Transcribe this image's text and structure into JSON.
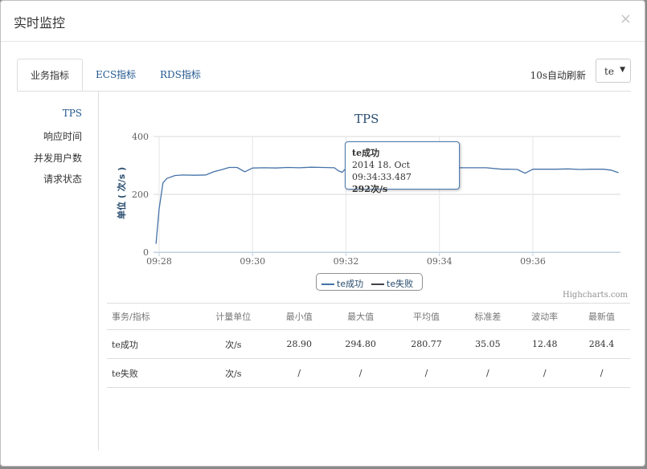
{
  "modal": {
    "title": "实时监控",
    "close": "×"
  },
  "tabs": [
    {
      "label": "业务指标",
      "active": true
    },
    {
      "label": "ECS指标",
      "active": false
    },
    {
      "label": "RDS指标",
      "active": false
    }
  ],
  "refresh": {
    "label": "10s自动刷新",
    "selected": "te"
  },
  "sidebar": {
    "items": [
      {
        "label": "TPS",
        "active": true
      },
      {
        "label": "响应时间",
        "active": false
      },
      {
        "label": "并发用户数",
        "active": false
      },
      {
        "label": "请求状态",
        "active": false
      }
    ]
  },
  "chart_data": {
    "type": "line",
    "title": "TPS",
    "ylabel": "单位 ( 次/s )",
    "xlabel": "",
    "ylim": [
      0,
      400
    ],
    "yticks": [
      "0",
      "200",
      "400"
    ],
    "xticks": [
      "09:28",
      "09:30",
      "09:32",
      "09:34",
      "09:36"
    ],
    "grid": true,
    "legend_position": "bottom",
    "series": [
      {
        "name": "te成功",
        "color": "#4572a7",
        "x": [
          "09:27:56",
          "09:28:00",
          "09:28:05",
          "09:28:10",
          "09:28:20",
          "09:28:30",
          "09:28:45",
          "09:29:00",
          "09:29:10",
          "09:29:20",
          "09:29:30",
          "09:29:40",
          "09:29:50",
          "09:30:00",
          "09:30:15",
          "09:30:30",
          "09:30:45",
          "09:31:00",
          "09:31:15",
          "09:31:30",
          "09:31:45",
          "09:31:50",
          "09:31:55",
          "09:32:00",
          "09:32:30",
          "09:33:00",
          "09:33:30",
          "09:34:00",
          "09:34:30",
          "09:35:00",
          "09:35:20",
          "09:35:30",
          "09:35:40",
          "09:35:50",
          "09:36:00",
          "09:36:15",
          "09:36:30",
          "09:36:45",
          "09:37:00",
          "09:37:15",
          "09:37:30",
          "09:37:40",
          "09:37:50"
        ],
        "y": [
          29,
          150,
          240,
          255,
          265,
          267,
          266,
          267,
          278,
          285,
          293,
          293,
          278,
          291,
          292,
          291,
          293,
          292,
          294,
          293,
          292,
          282,
          276,
          290,
          292,
          291,
          292,
          292,
          292,
          292,
          287,
          287,
          286,
          273,
          287,
          287,
          287,
          288,
          286,
          287,
          287,
          284,
          275
        ]
      },
      {
        "name": "te失败",
        "color": "#434348",
        "x": [],
        "y": []
      }
    ],
    "tooltip": {
      "title": "te成功",
      "time": "2014 18. Oct 09:34:33.487",
      "value": "292次/s"
    },
    "credits": "Highcharts.com"
  },
  "table": {
    "headers": [
      "事务/指标",
      "计量单位",
      "最小值",
      "最大值",
      "平均值",
      "标准差",
      "波动率",
      "最新值"
    ],
    "rows": [
      [
        "te成功",
        "次/s",
        "28.90",
        "294.80",
        "280.77",
        "35.05",
        "12.48",
        "284.4"
      ],
      [
        "te失败",
        "次/s",
        "/",
        "/",
        "/",
        "/",
        "/",
        "/"
      ]
    ]
  }
}
